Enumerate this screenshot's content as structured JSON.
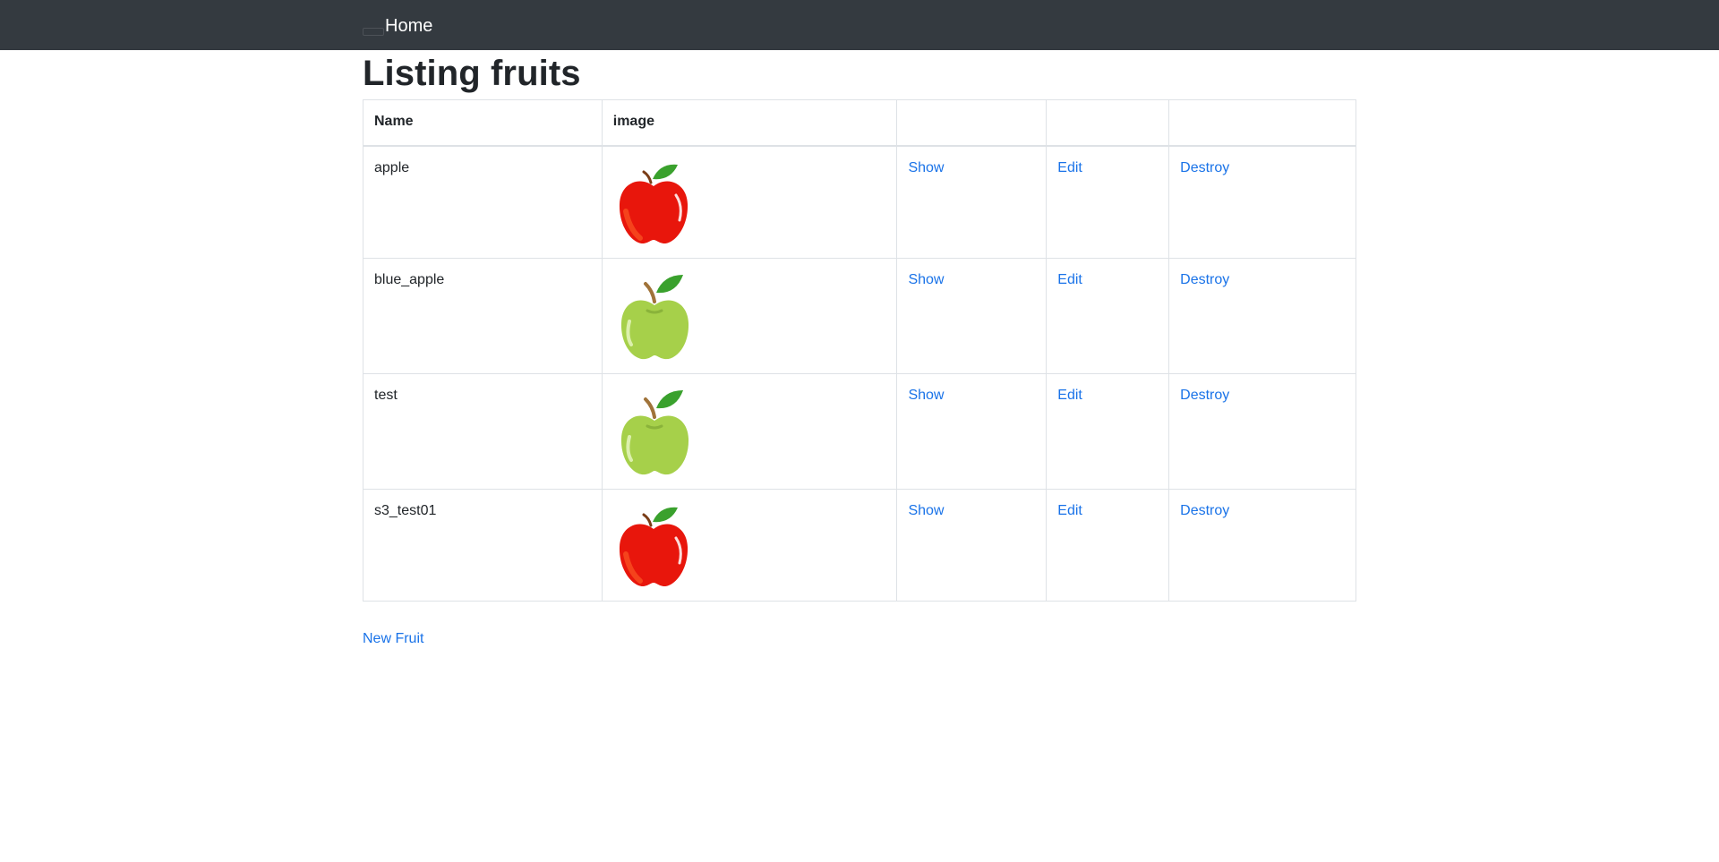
{
  "nav": {
    "brand": "Home"
  },
  "page": {
    "title": "Listing fruits"
  },
  "table": {
    "headers": [
      "Name",
      "image",
      "",
      "",
      ""
    ],
    "rows": [
      {
        "name": "apple",
        "image_icon": "red-apple-icon",
        "show": "Show",
        "edit": "Edit",
        "destroy": "Destroy"
      },
      {
        "name": "blue_apple",
        "image_icon": "green-apple-icon",
        "show": "Show",
        "edit": "Edit",
        "destroy": "Destroy"
      },
      {
        "name": "test",
        "image_icon": "green-apple-icon",
        "show": "Show",
        "edit": "Edit",
        "destroy": "Destroy"
      },
      {
        "name": "s3_test01",
        "image_icon": "red-apple-icon",
        "show": "Show",
        "edit": "Edit",
        "destroy": "Destroy"
      }
    ]
  },
  "footer": {
    "new_label": "New Fruit"
  },
  "colors": {
    "navbar": "#343a40",
    "link": "#1a73e8",
    "red_apple": "#e8160c",
    "green_apple": "#a6d04a",
    "leaf": "#3aa12d"
  }
}
